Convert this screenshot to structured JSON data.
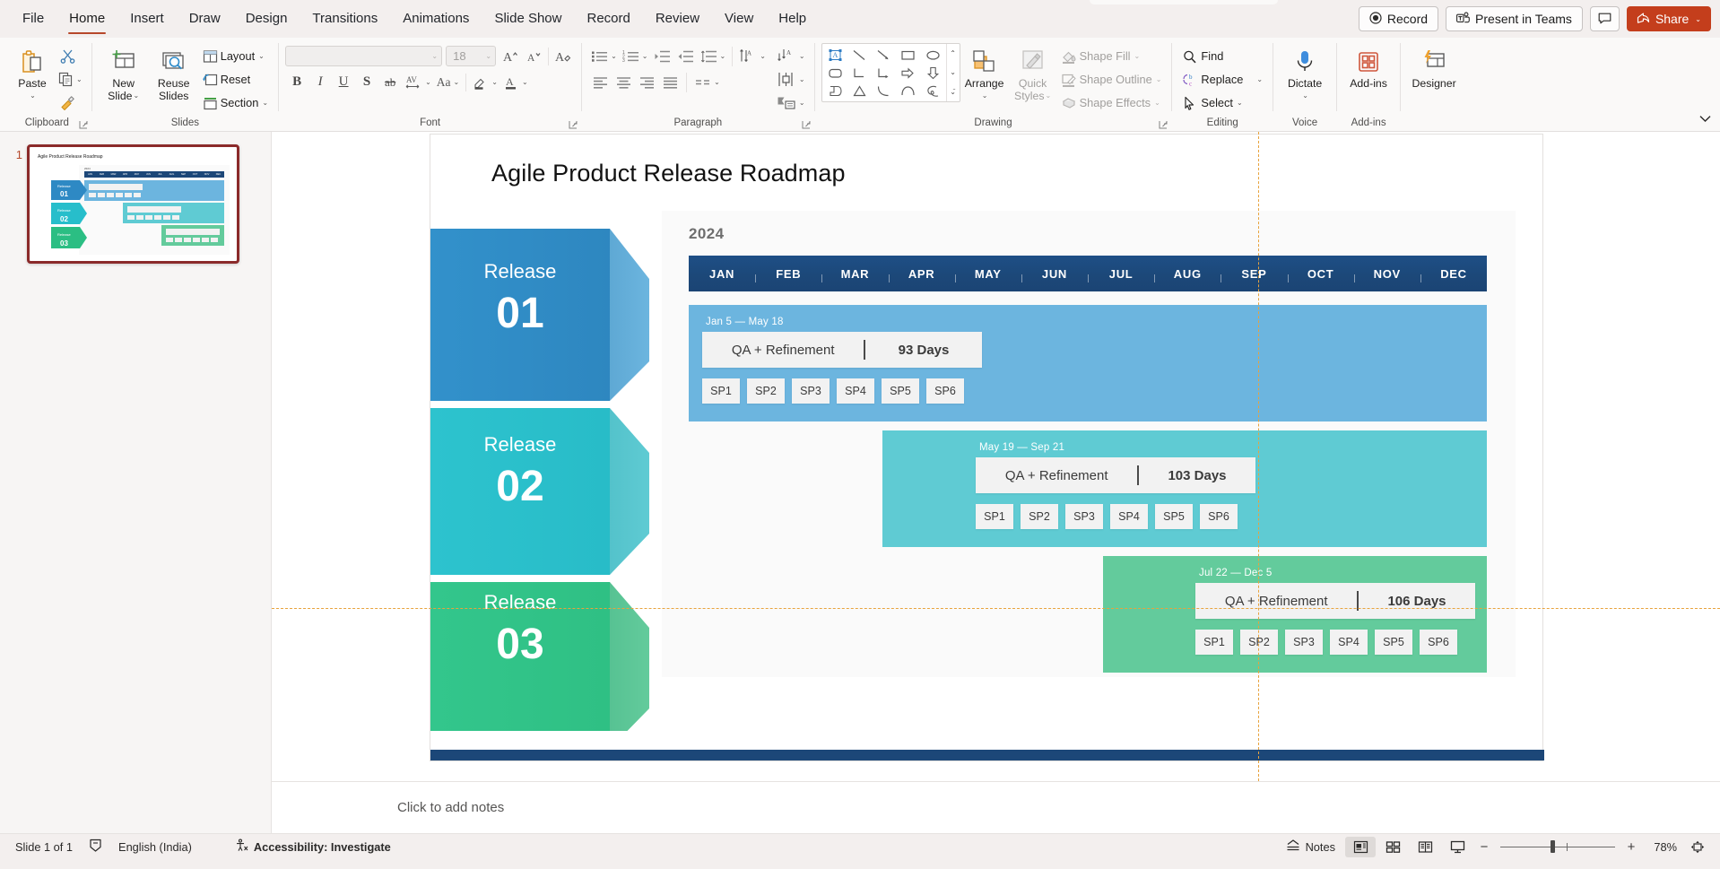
{
  "app": {
    "tabs": [
      {
        "label": "File",
        "active": false
      },
      {
        "label": "Home",
        "active": true
      },
      {
        "label": "Insert",
        "active": false
      },
      {
        "label": "Draw",
        "active": false
      },
      {
        "label": "Design",
        "active": false
      },
      {
        "label": "Transitions",
        "active": false
      },
      {
        "label": "Animations",
        "active": false
      },
      {
        "label": "Slide Show",
        "active": false
      },
      {
        "label": "Record",
        "active": false
      },
      {
        "label": "Review",
        "active": false
      },
      {
        "label": "View",
        "active": false
      },
      {
        "label": "Help",
        "active": false
      }
    ],
    "title_right": {
      "record": "Record",
      "present_in_teams": "Present in Teams",
      "comments_tooltip": "Comments",
      "share": "Share"
    }
  },
  "ribbon": {
    "groups": {
      "clipboard": {
        "label": "Clipboard",
        "paste": "Paste",
        "cut_tooltip": "Cut",
        "copy_tooltip": "Copy",
        "format_painter_tooltip": "Format Painter"
      },
      "slides": {
        "label": "Slides",
        "new_slide": "New\nSlide",
        "new_slide_l1": "New",
        "new_slide_l2": "Slide",
        "reuse_slides_l1": "Reuse",
        "reuse_slides_l2": "Slides",
        "layout": "Layout",
        "reset": "Reset",
        "section": "Section"
      },
      "font": {
        "label": "Font",
        "font_name_value": "",
        "font_size_value": "18",
        "bold": "B",
        "italic": "I",
        "underline": "U",
        "shadow": "S",
        "strikethrough": "ab",
        "character_spacing": "AV",
        "change_case": "Aa",
        "grow_tooltip": "Increase Font Size",
        "shrink_tooltip": "Decrease Font Size",
        "clear_formatting_tooltip": "Clear All Formatting",
        "highlight_tooltip": "Text Highlight Color",
        "font_color_tooltip": "Font Color"
      },
      "paragraph": {
        "label": "Paragraph",
        "bullets_tooltip": "Bullets",
        "numbering_tooltip": "Numbering",
        "decrease_indent_tooltip": "Decrease List Level",
        "increase_indent_tooltip": "Increase List Level",
        "line_spacing_tooltip": "Line Spacing",
        "align_left_tooltip": "Align Left",
        "align_center_tooltip": "Center",
        "align_right_tooltip": "Align Right",
        "justify_tooltip": "Justify",
        "columns_tooltip": "Columns",
        "text_direction_tooltip": "Text Direction",
        "align_text_tooltip": "Align Text",
        "smartart_tooltip": "Convert to SmartArt"
      },
      "drawing": {
        "label": "Drawing",
        "arrange": "Arrange",
        "quick_styles_l1": "Quick",
        "quick_styles_l2": "Styles",
        "shape_fill": "Shape Fill",
        "shape_outline": "Shape Outline",
        "shape_effects": "Shape Effects"
      },
      "editing": {
        "label": "Editing",
        "find": "Find",
        "replace": "Replace",
        "select": "Select"
      },
      "voice": {
        "label": "Voice",
        "dictate": "Dictate"
      },
      "addins": {
        "label": "Add-ins",
        "addins": "Add-ins"
      },
      "designer": {
        "designer": "Designer"
      }
    }
  },
  "thumbnail_pane": {
    "slide_number": "1"
  },
  "slide": {
    "title": "Agile Product Release Roadmap",
    "year": "2024",
    "months": [
      "JAN",
      "FEB",
      "MAR",
      "APR",
      "MAY",
      "JUN",
      "JUL",
      "AUG",
      "SEP",
      "OCT",
      "NOV",
      "DEC"
    ],
    "qa_label": "QA + Refinement",
    "releases": [
      {
        "name": "Release",
        "number": "01",
        "date_range": "Jan 5 — May 18",
        "qa_label": "QA + Refinement",
        "days": "93 Days",
        "sprints": [
          "SP1",
          "SP2",
          "SP3",
          "SP4",
          "SP5",
          "SP6"
        ],
        "color": "#6CB5DF",
        "color_dark": "#2E89C4"
      },
      {
        "name": "Release",
        "number": "02",
        "date_range": "May 19 — Sep 21",
        "qa_label": "QA + Refinement",
        "days": "103 Days",
        "sprints": [
          "SP1",
          "SP2",
          "SP3",
          "SP4",
          "SP5",
          "SP6"
        ],
        "color": "#5FCBD3",
        "color_dark": "#27BECB"
      },
      {
        "name": "Release",
        "number": "03",
        "date_range": "Jul 22 — Dec 5",
        "qa_label": "QA + Refinement",
        "days": "106 Days",
        "sprints": [
          "SP1",
          "SP2",
          "SP3",
          "SP4",
          "SP5",
          "SP6"
        ],
        "color": "#63CB9C",
        "color_dark": "#2BBE83"
      }
    ],
    "colors": {
      "month_bar": "#1C4778",
      "footer_bar": "#1C4778",
      "panel_bg": "#FAFAFA",
      "chip_bg": "#F2F2F2"
    }
  },
  "notes": {
    "placeholder": "Click to add notes"
  },
  "status_bar": {
    "slide_count": "Slide 1 of 1",
    "spellcheck_tooltip": "Spelling and Grammar Check",
    "language": "English (India)",
    "accessibility": "Accessibility: Investigate",
    "notes": "Notes",
    "view_normal_tooltip": "Normal",
    "view_sorter_tooltip": "Slide Sorter",
    "view_reading_tooltip": "Reading View",
    "view_slideshow_tooltip": "Slide Show",
    "zoom_out": "−",
    "zoom_in": "+",
    "zoom_level": "78%",
    "fit_tooltip": "Fit slide to current window"
  }
}
